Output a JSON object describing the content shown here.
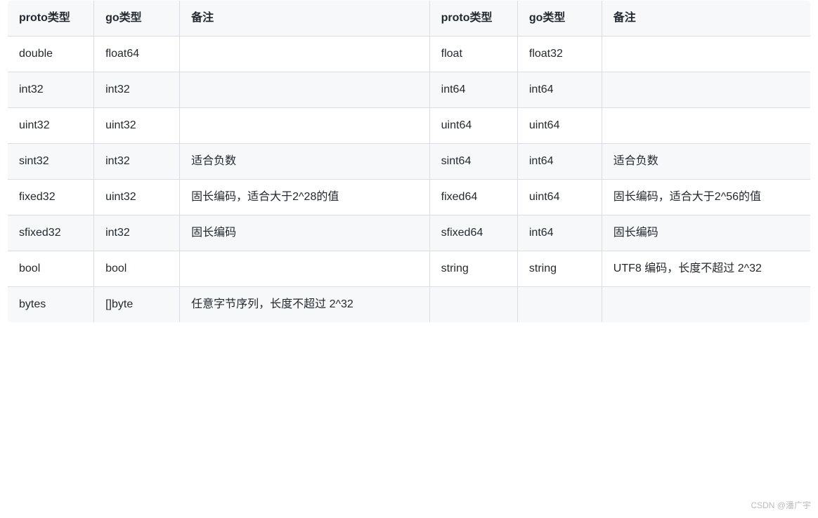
{
  "table": {
    "headers": {
      "proto1": "proto类型",
      "go1": "go类型",
      "note1": "备注",
      "proto2": "proto类型",
      "go2": "go类型",
      "note2": "备注"
    },
    "rows": [
      {
        "proto1": "double",
        "go1": "float64",
        "note1": "",
        "proto2": "float",
        "go2": "float32",
        "note2": ""
      },
      {
        "proto1": "int32",
        "go1": "int32",
        "note1": "",
        "proto2": "int64",
        "go2": "int64",
        "note2": ""
      },
      {
        "proto1": "uint32",
        "go1": "uint32",
        "note1": "",
        "proto2": "uint64",
        "go2": "uint64",
        "note2": ""
      },
      {
        "proto1": "sint32",
        "go1": "int32",
        "note1": "适合负数",
        "proto2": "sint64",
        "go2": "int64",
        "note2": "适合负数"
      },
      {
        "proto1": "fixed32",
        "go1": "uint32",
        "note1": "固长编码，适合大于2^28的值",
        "proto2": "fixed64",
        "go2": "uint64",
        "note2": "固长编码，适合大于2^56的值"
      },
      {
        "proto1": "sfixed32",
        "go1": "int32",
        "note1": "固长编码",
        "proto2": "sfixed64",
        "go2": "int64",
        "note2": "固长编码"
      },
      {
        "proto1": "bool",
        "go1": "bool",
        "note1": "",
        "proto2": "string",
        "go2": "string",
        "note2": "UTF8 编码，长度不超过 2^32"
      },
      {
        "proto1": "bytes",
        "go1": "[]byte",
        "note1": "任意字节序列，长度不超过 2^32",
        "proto2": "",
        "go2": "",
        "note2": ""
      }
    ]
  },
  "watermark": "CSDN @潘广宇"
}
